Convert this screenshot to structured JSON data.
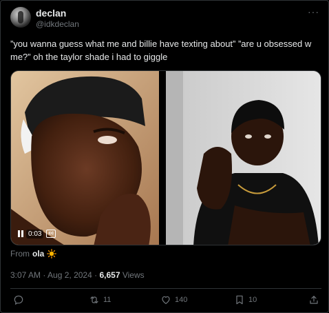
{
  "author": {
    "display_name": "declan",
    "handle": "@idkdeclan"
  },
  "more_label": "···",
  "tweet": {
    "text": "”you wanna guess what me and billie have texting about” ”are u obsessed w me?” oh the taylor shade i had to giggle"
  },
  "video": {
    "time": "0:03",
    "cc_label": "cc"
  },
  "source": {
    "prefix": "From",
    "name": "ola"
  },
  "meta": {
    "time": "3:07 AM",
    "separator": "·",
    "date": "Aug 2, 2024",
    "views_count": "6,657",
    "views_label": "Views"
  },
  "actions": {
    "reply": {
      "icon": "reply-icon",
      "count": ""
    },
    "retweet": {
      "icon": "retweet-icon",
      "count": "11"
    },
    "like": {
      "icon": "heart-icon",
      "count": "140"
    },
    "bookmark": {
      "icon": "bookmark-icon",
      "count": "10"
    },
    "share": {
      "icon": "share-icon",
      "count": ""
    }
  },
  "colors": {
    "background": "#000000",
    "text_primary": "#e7e9ea",
    "text_secondary": "#71767b",
    "border": "#2f3336"
  }
}
